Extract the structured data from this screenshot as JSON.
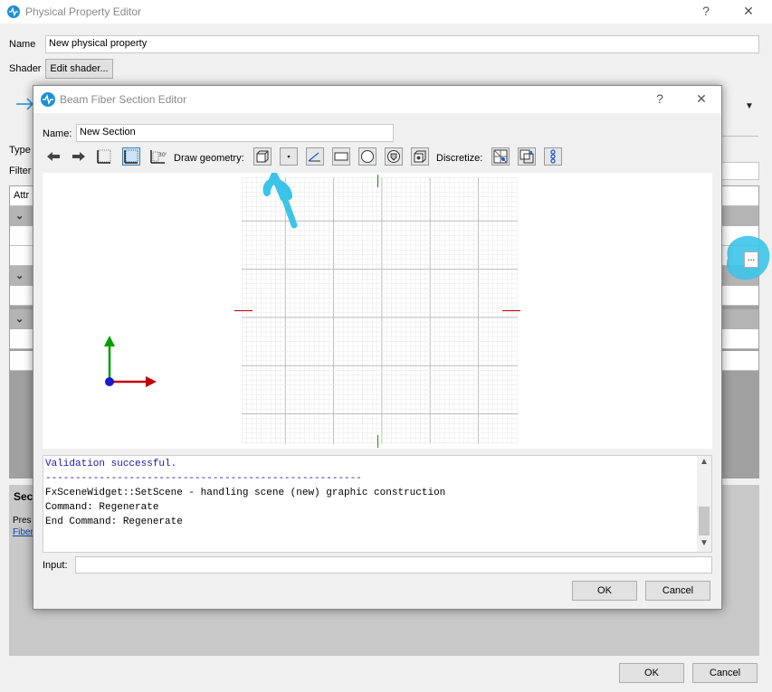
{
  "outer": {
    "title": "Physical Property Editor",
    "help_glyph": "?",
    "close_glyph": "✕",
    "name_label": "Name",
    "name_value": "New physical property",
    "shader_label": "Shader",
    "shader_button": "Edit shader...",
    "type_label": "Type",
    "filter_label": "Filter",
    "attr_label": "Attr",
    "section_label": "Sec",
    "press_text": "Pres",
    "fiber_link": "Fiber",
    "ellipsis_button": "...",
    "ok": "OK",
    "cancel": "Cancel"
  },
  "dialog": {
    "title": "Beam Fiber Section Editor",
    "help_glyph": "?",
    "close_glyph": "✕",
    "name_label": "Name:",
    "name_value": "New Section",
    "draw_geometry_label": "Draw geometry:",
    "discretize_label": "Discretize:",
    "console_lines": [
      {
        "text": "Validation successful.",
        "color": "#1a1aa6"
      },
      {
        "text": "-----------------------------------------------------",
        "color": "#1a1aa6"
      },
      {
        "text": "FxSceneWidget::SetScene - handling scene (new) graphic construction",
        "color": "#000000"
      },
      {
        "text": "Command: Regenerate",
        "color": "#000000"
      },
      {
        "text": "End Command: Regenerate",
        "color": "#000000"
      }
    ],
    "input_label": "Input:",
    "input_value": "",
    "ok": "OK",
    "cancel": "Cancel"
  },
  "toolbar_icons": [
    "arrow-left-icon",
    "arrow-right-icon",
    "grid-snap-icon",
    "grid-icon",
    "angle-grid-icon"
  ],
  "geometry_icons": [
    "patch-icon",
    "point-icon",
    "line-icon",
    "rectangle-icon",
    "circle-icon",
    "polygon-icon",
    "fiber-group-icon"
  ],
  "discretize_icons": [
    "mesh-icon",
    "edge-icon",
    "fiber-chain-icon"
  ],
  "colors": {
    "annotation": "#3cc4e8",
    "axis_x": "#c00000",
    "axis_y": "#00a000",
    "axis_origin": "#1a1ad0"
  }
}
